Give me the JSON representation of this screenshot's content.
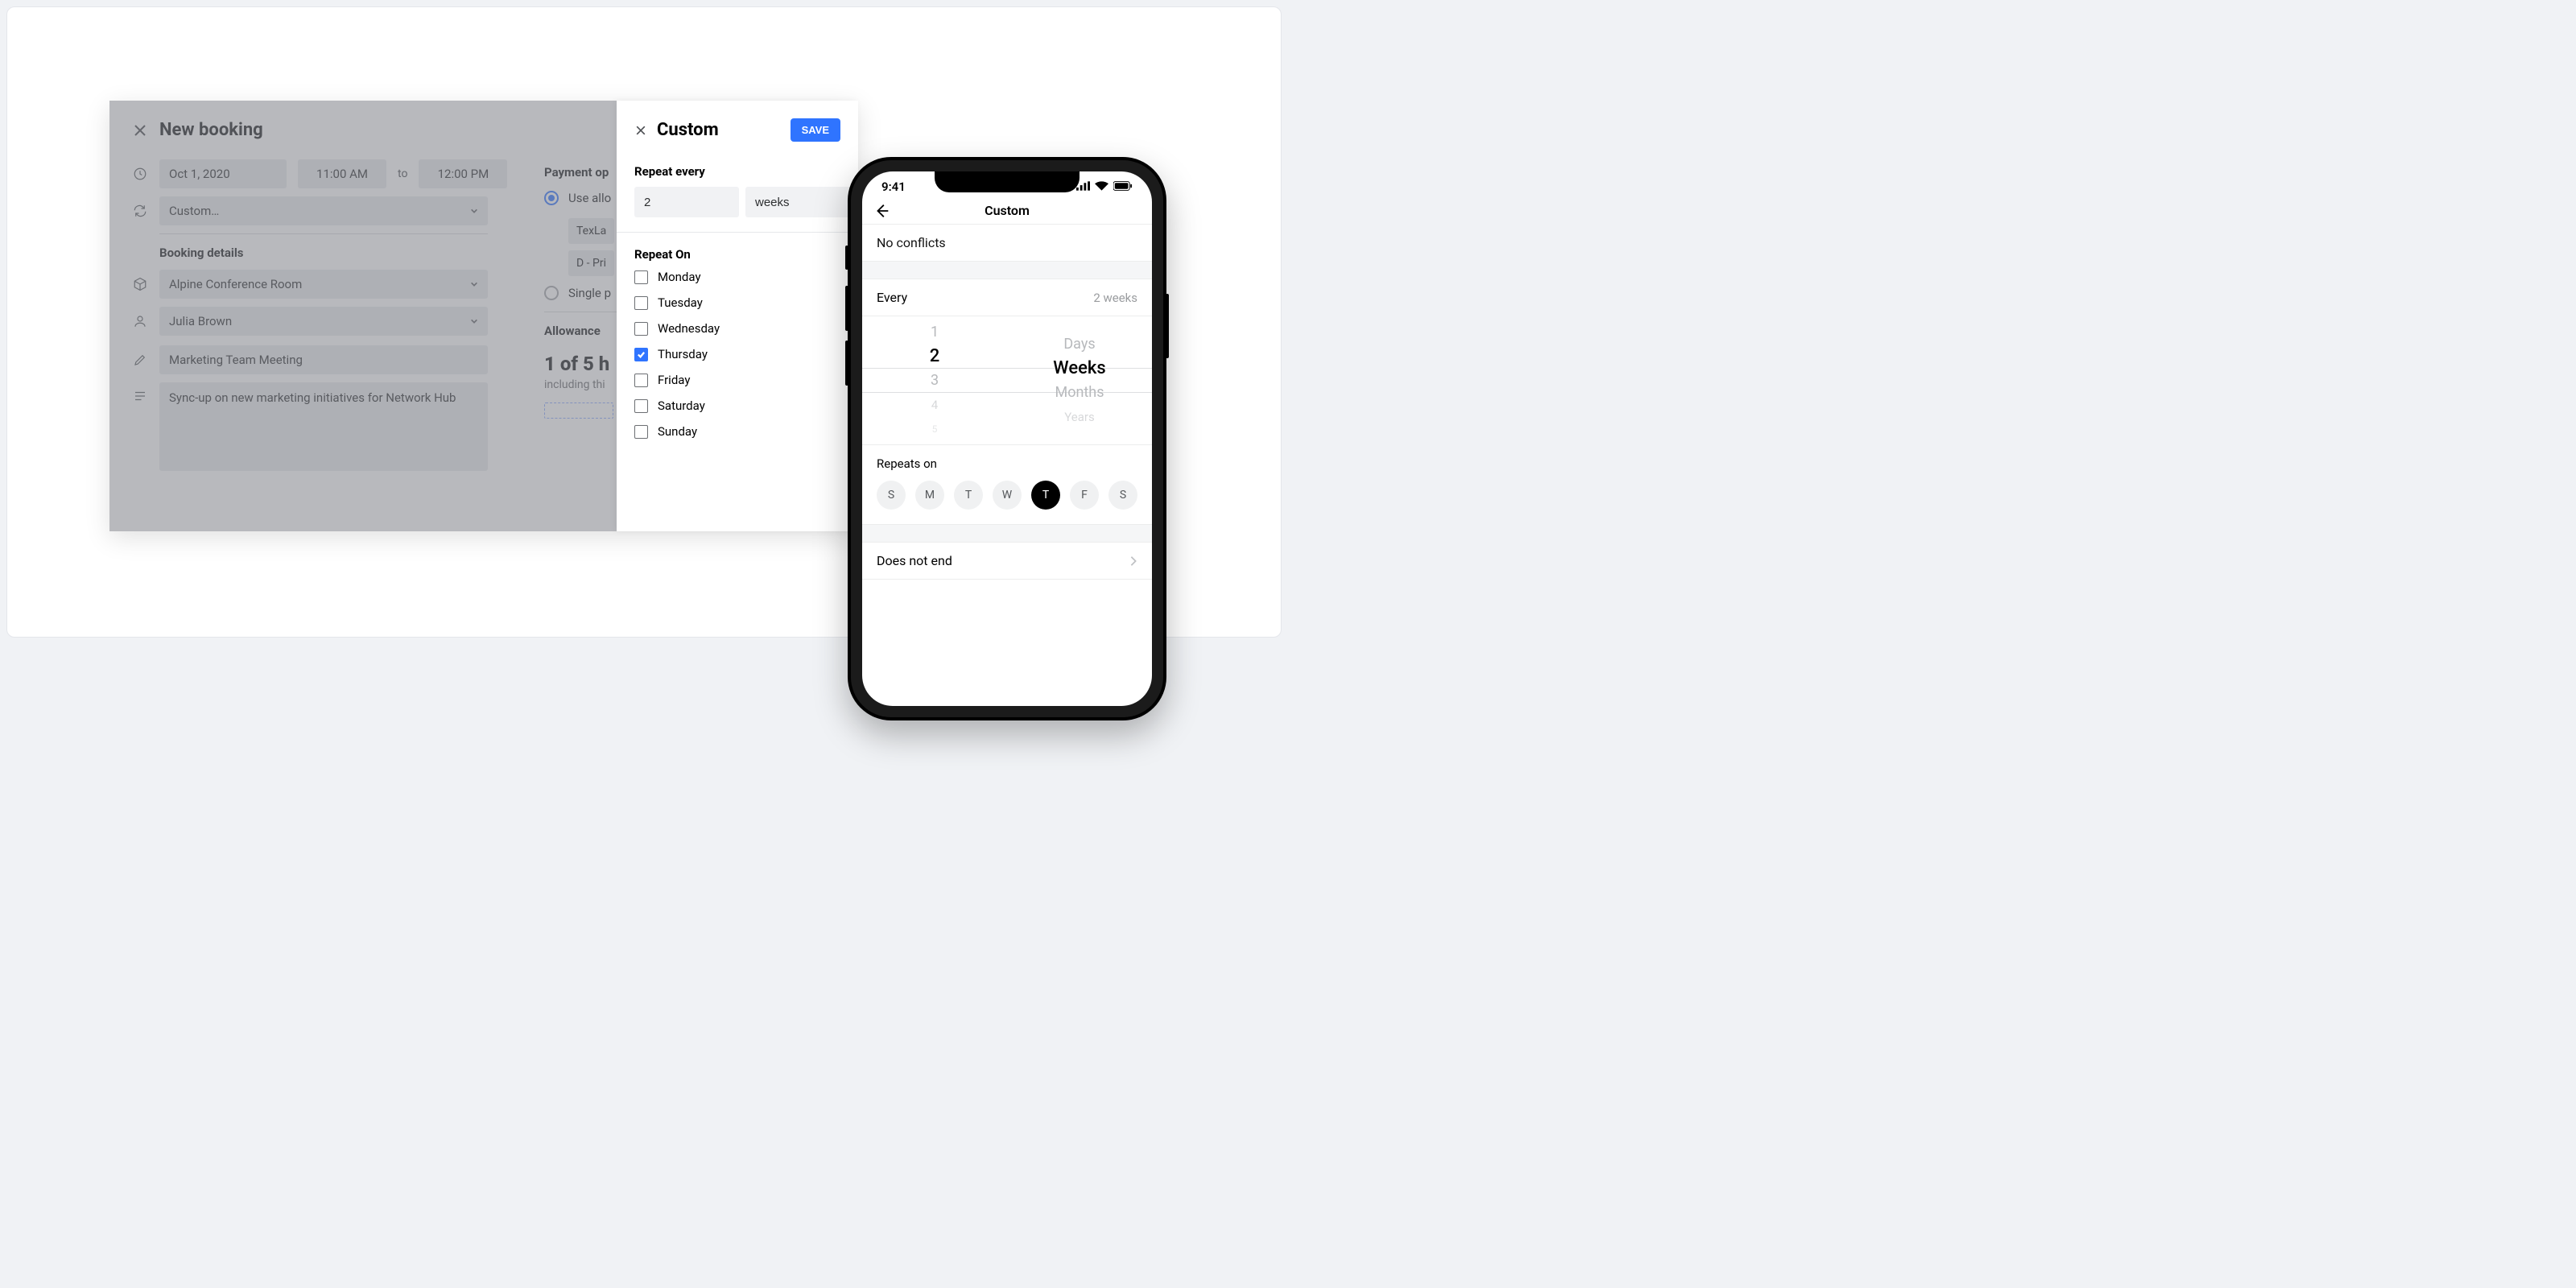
{
  "booking": {
    "title": "New booking",
    "date": "Oct 1, 2020",
    "start_time": "11:00 AM",
    "to": "to",
    "end_time": "12:00 PM",
    "recurrence_select": "Custom…",
    "section_details": "Booking details",
    "room": "Alpine Conference Room",
    "user": "Julia Brown",
    "name": "Marketing Team Meeting",
    "desc": "Sync-up on new marketing initiatives for Network Hub"
  },
  "payment": {
    "title": "Payment op",
    "opt_allow": "Use allo",
    "tag1": "TexLa",
    "tag2": "D - Pri",
    "opt_single": "Single p",
    "allowance_title": "Allowance",
    "allowance_value": "1 of 5 h",
    "allowance_sub": "including thi"
  },
  "drawer": {
    "title": "Custom",
    "save": "SAVE",
    "repeat_every_label": "Repeat every",
    "repeat_count": "2",
    "repeat_unit": "weeks",
    "repeat_on_label": "Repeat On",
    "days": [
      {
        "label": "Monday",
        "checked": false
      },
      {
        "label": "Tuesday",
        "checked": false
      },
      {
        "label": "Wednesday",
        "checked": false
      },
      {
        "label": "Thursday",
        "checked": true
      },
      {
        "label": "Friday",
        "checked": false
      },
      {
        "label": "Saturday",
        "checked": false
      },
      {
        "label": "Sunday",
        "checked": false
      }
    ]
  },
  "phone": {
    "time": "9:41",
    "title": "Custom",
    "conflicts": "No conflicts",
    "every_label": "Every",
    "every_value": "2 weeks",
    "picker_numbers": [
      "1",
      "2",
      "3",
      "4",
      "5"
    ],
    "picker_units": [
      "Days",
      "Weeks",
      "Months",
      "Years"
    ],
    "selected_number": "2",
    "selected_unit": "Weeks",
    "repeats_on": "Repeats on",
    "day_pills": [
      {
        "label": "S",
        "selected": false
      },
      {
        "label": "M",
        "selected": false
      },
      {
        "label": "T",
        "selected": false
      },
      {
        "label": "W",
        "selected": false
      },
      {
        "label": "T",
        "selected": true
      },
      {
        "label": "F",
        "selected": false
      },
      {
        "label": "S",
        "selected": false
      }
    ],
    "end": "Does not end"
  }
}
